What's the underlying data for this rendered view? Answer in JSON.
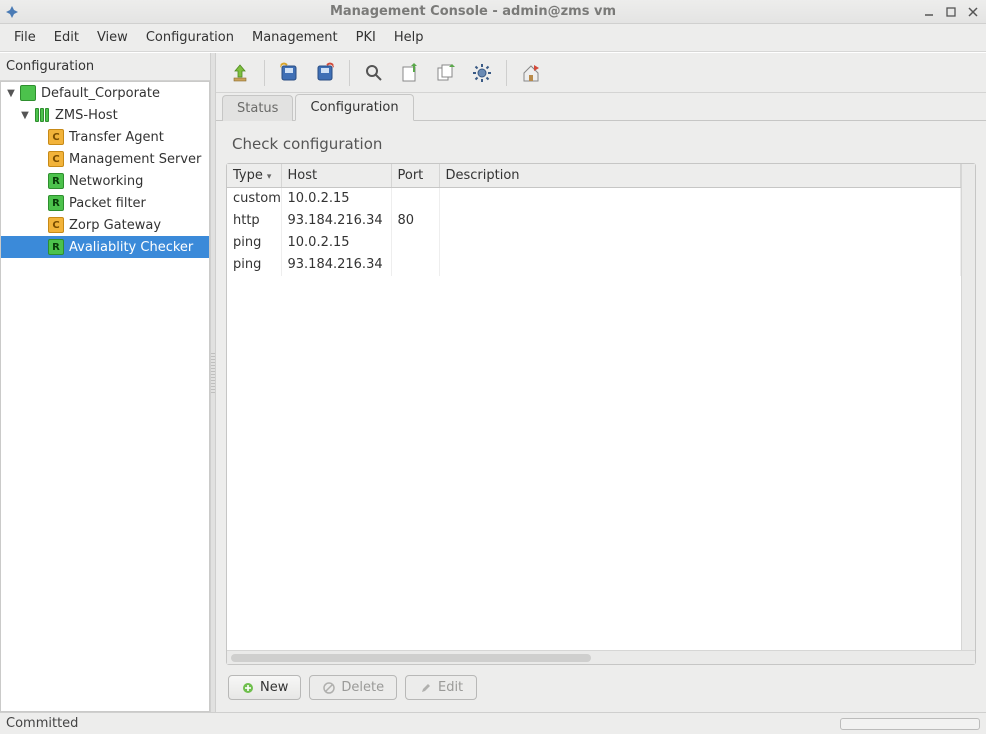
{
  "window": {
    "title": "Management Console - admin@zms vm"
  },
  "menu": {
    "items": [
      "File",
      "Edit",
      "View",
      "Configuration",
      "Management",
      "PKI",
      "Help"
    ]
  },
  "sidebar": {
    "heading": "Configuration",
    "root": {
      "label": "Default_Corporate",
      "host": {
        "label": "ZMS-Host",
        "children": [
          {
            "label": "Transfer Agent",
            "badge": "C",
            "color": "orange"
          },
          {
            "label": "Management Server",
            "badge": "C",
            "color": "orange"
          },
          {
            "label": "Networking",
            "badge": "R",
            "color": "green"
          },
          {
            "label": "Packet filter",
            "badge": "R",
            "color": "green"
          },
          {
            "label": "Zorp Gateway",
            "badge": "C",
            "color": "orange"
          },
          {
            "label": "Avaliablity Checker",
            "badge": "R",
            "color": "green",
            "selected": true
          }
        ]
      }
    }
  },
  "tabs": {
    "items": [
      "Status",
      "Configuration"
    ],
    "active": 1
  },
  "section": {
    "title": "Check configuration"
  },
  "table": {
    "columns": [
      "Type",
      "Host",
      "Port",
      "Description"
    ],
    "rows": [
      {
        "type": "custom",
        "host": "10.0.2.15",
        "port": "",
        "desc": ""
      },
      {
        "type": "http",
        "host": "93.184.216.34",
        "port": "80",
        "desc": ""
      },
      {
        "type": "ping",
        "host": "10.0.2.15",
        "port": "",
        "desc": ""
      },
      {
        "type": "ping",
        "host": "93.184.216.34",
        "port": "",
        "desc": ""
      }
    ]
  },
  "buttons": {
    "new": "New",
    "delete": "Delete",
    "edit": "Edit"
  },
  "status": {
    "text": "Committed"
  },
  "toolbar_icons": [
    "upload",
    "save-blue",
    "save-red",
    "search",
    "export",
    "multi-export",
    "gear",
    "home-flag"
  ]
}
